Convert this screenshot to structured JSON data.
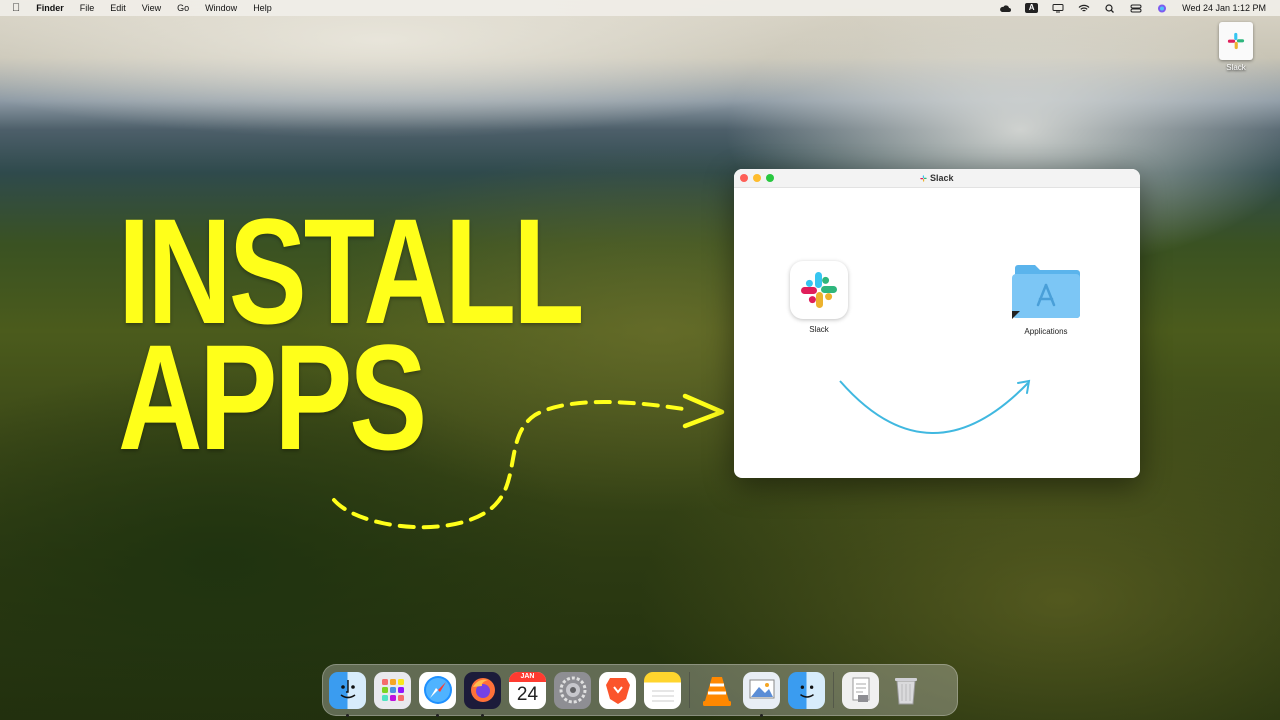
{
  "menubar": {
    "app_name": "Finder",
    "menus": [
      "File",
      "Edit",
      "View",
      "Go",
      "Window",
      "Help"
    ],
    "keyboard_indicator": "A",
    "datetime": "Wed 24 Jan  1:12 PM"
  },
  "desktop": {
    "slack_icon_label": "Slack"
  },
  "headline": {
    "line1": "INSTALL",
    "line2": "APPS",
    "color": "#ffff1a"
  },
  "window": {
    "title": "Slack",
    "app_label": "Slack",
    "folder_label": "Applications",
    "arrow_color": "#40b8e0"
  },
  "dock": {
    "calendar_month": "JAN",
    "calendar_day": "24",
    "items": [
      "finder-icon",
      "launchpad-icon",
      "safari-icon",
      "firefox-icon",
      "calendar-icon",
      "system-settings-icon",
      "brave-icon",
      "notes-icon",
      "vlc-icon",
      "preview-icon",
      "finder-alt-icon",
      "documents-icon",
      "trash-icon"
    ]
  }
}
